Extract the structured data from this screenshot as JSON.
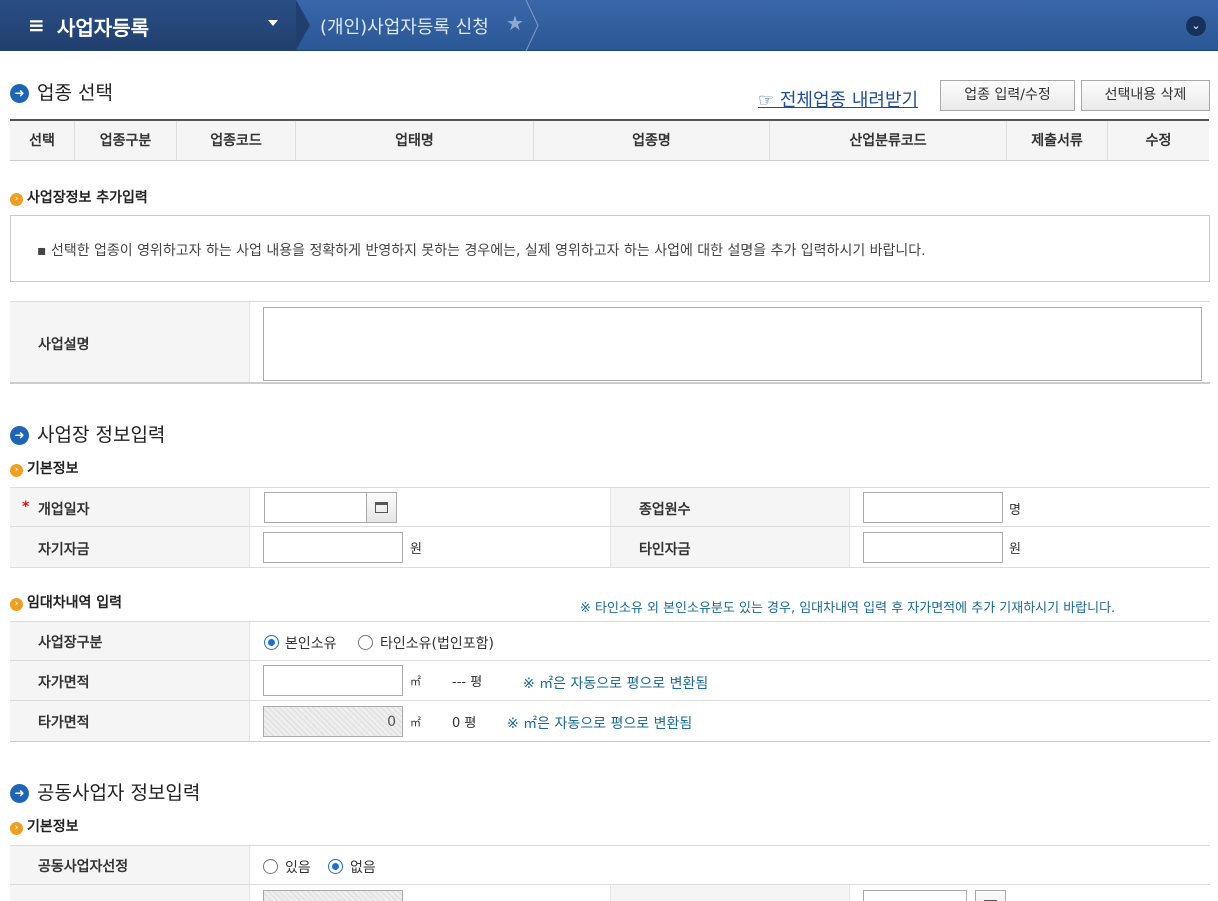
{
  "header": {
    "menu_icon": "≡",
    "menu_title": "사업자등록",
    "breadcrumb": "(개인)사업자등록 신청",
    "star_icon": "★",
    "expand_icon": "⌄"
  },
  "business_type": {
    "heading": "업종 선택",
    "download_link": "☞ 전체업종 내려받기",
    "edit_button": "업종 입력/수정",
    "delete_button": "선택내용 삭제",
    "columns": [
      "선택",
      "업종구분",
      "업종코드",
      "업태명",
      "업종명",
      "산업분류코드",
      "제출서류",
      "수정"
    ]
  },
  "extra_info": {
    "heading": "사업장정보 추가입력",
    "notice": "▪ 선택한 업종이 영위하고자 하는 사업 내용을 정확하게 반영하지 못하는 경우에는, 실제 영위하고자 하는 사업에 대한 설명을 추가 입력하시기 바랍니다.",
    "description_label": "사업설명",
    "description_value": ""
  },
  "site_info": {
    "heading": "사업장 정보입력",
    "basic_heading": "기본정보",
    "required_mark": "*",
    "open_date_label": "개업일자",
    "open_date_value": "",
    "employees_label": "종업원수",
    "employees_value": "",
    "employees_unit": "명",
    "own_capital_label": "자기자금",
    "own_capital_value": "",
    "own_capital_unit": "원",
    "other_capital_label": "타인자금",
    "other_capital_value": "",
    "other_capital_unit": "원"
  },
  "lease": {
    "heading": "임대차내역 입력",
    "notice": "※ 타인소유 외 본인소유분도 있는 경우, 임대차내역 입력 후 자가면적에 추가 기재하시기 바랍니다.",
    "type_label": "사업장구분",
    "option_own": "본인소유",
    "option_other": "타인소유(법인포함)",
    "selected": "본인소유",
    "own_area_label": "자가면적",
    "own_area_value": "",
    "area_unit": "㎡",
    "own_pyeong": "--- 평",
    "convert_note": "※ ㎡은 자동으로 평으로 변환됨",
    "other_area_label": "타가면적",
    "other_area_value": "0",
    "other_pyeong": "0 평"
  },
  "partner": {
    "heading": "공동사업자 정보입력",
    "basic_heading": "기본정보",
    "select_label": "공동사업자선정",
    "option_yes": "있음",
    "option_no": "없음",
    "selected": "없음"
  }
}
